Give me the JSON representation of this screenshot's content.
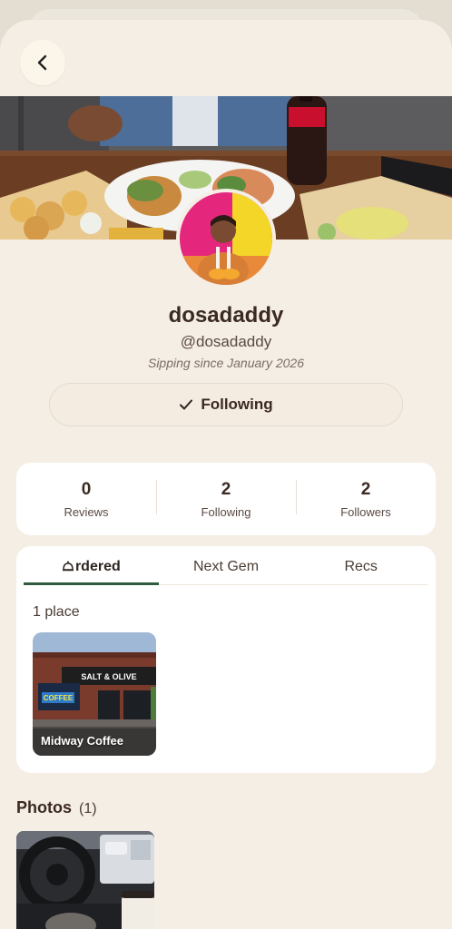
{
  "profile": {
    "display_name": "dosadaddy",
    "handle": "@dosadaddy",
    "since": "Sipping since January 2026",
    "follow_label": "Following"
  },
  "stats": [
    {
      "value": "0",
      "label": "Reviews"
    },
    {
      "value": "2",
      "label": "Following"
    },
    {
      "value": "2",
      "label": "Followers"
    }
  ],
  "tabs": [
    {
      "label": "rdered",
      "icon": "bell-icon",
      "active": true
    },
    {
      "label": "Next Gem",
      "active": false
    },
    {
      "label": "Recs",
      "active": false
    }
  ],
  "ordered": {
    "count_label": "1 place",
    "places": [
      {
        "name": "Midway Coffee",
        "sign_text": "SALT & OLIVE",
        "mural_text": "COFFEE"
      }
    ]
  },
  "photos": {
    "title": "Photos",
    "count": "(1)"
  },
  "colors": {
    "background": "#f5eee4",
    "accent": "#2f5b3e",
    "text": "#3b2a22"
  }
}
